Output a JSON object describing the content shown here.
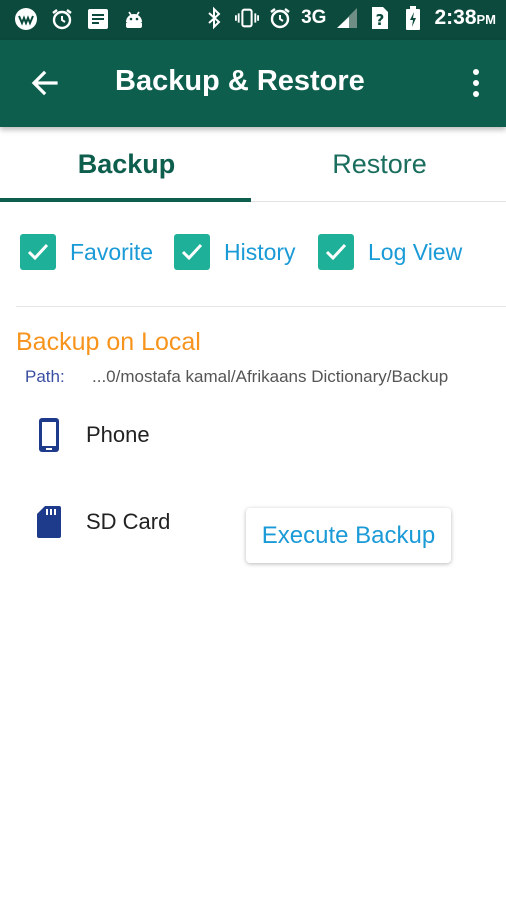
{
  "status_bar": {
    "network": "3G",
    "time": "2:38",
    "ampm": "PM",
    "icons": [
      "app-logo-icon",
      "alarm-icon",
      "notes-icon",
      "android-icon",
      "bluetooth-icon",
      "vibrate-icon",
      "alarm-icon",
      "signal-icon",
      "unknown-sim-icon",
      "battery-icon"
    ]
  },
  "app_bar": {
    "title": "Backup & Restore"
  },
  "tabs": [
    {
      "label": "Backup",
      "selected": true
    },
    {
      "label": "Restore",
      "selected": false
    }
  ],
  "options": [
    {
      "label": "Favorite",
      "checked": true
    },
    {
      "label": "History",
      "checked": true
    },
    {
      "label": "Log View",
      "checked": true
    }
  ],
  "backup_local": {
    "title": "Backup on Local",
    "path_label": "Path:",
    "path_value": "...0/mostafa kamal/Afrikaans Dictionary/Backup",
    "locations": [
      {
        "label": "Phone",
        "icon": "phone-icon"
      },
      {
        "label": "SD Card",
        "icon": "sd-card-icon"
      }
    ],
    "execute_label": "Execute Backup"
  },
  "colors": {
    "status_bar": "#0b4a3c",
    "app_bar": "#0e5e4e",
    "accent_teal": "#1fb09a",
    "link_blue": "#1a9ad6",
    "section_orange": "#f7941d",
    "icon_navy": "#1e3a8a"
  }
}
